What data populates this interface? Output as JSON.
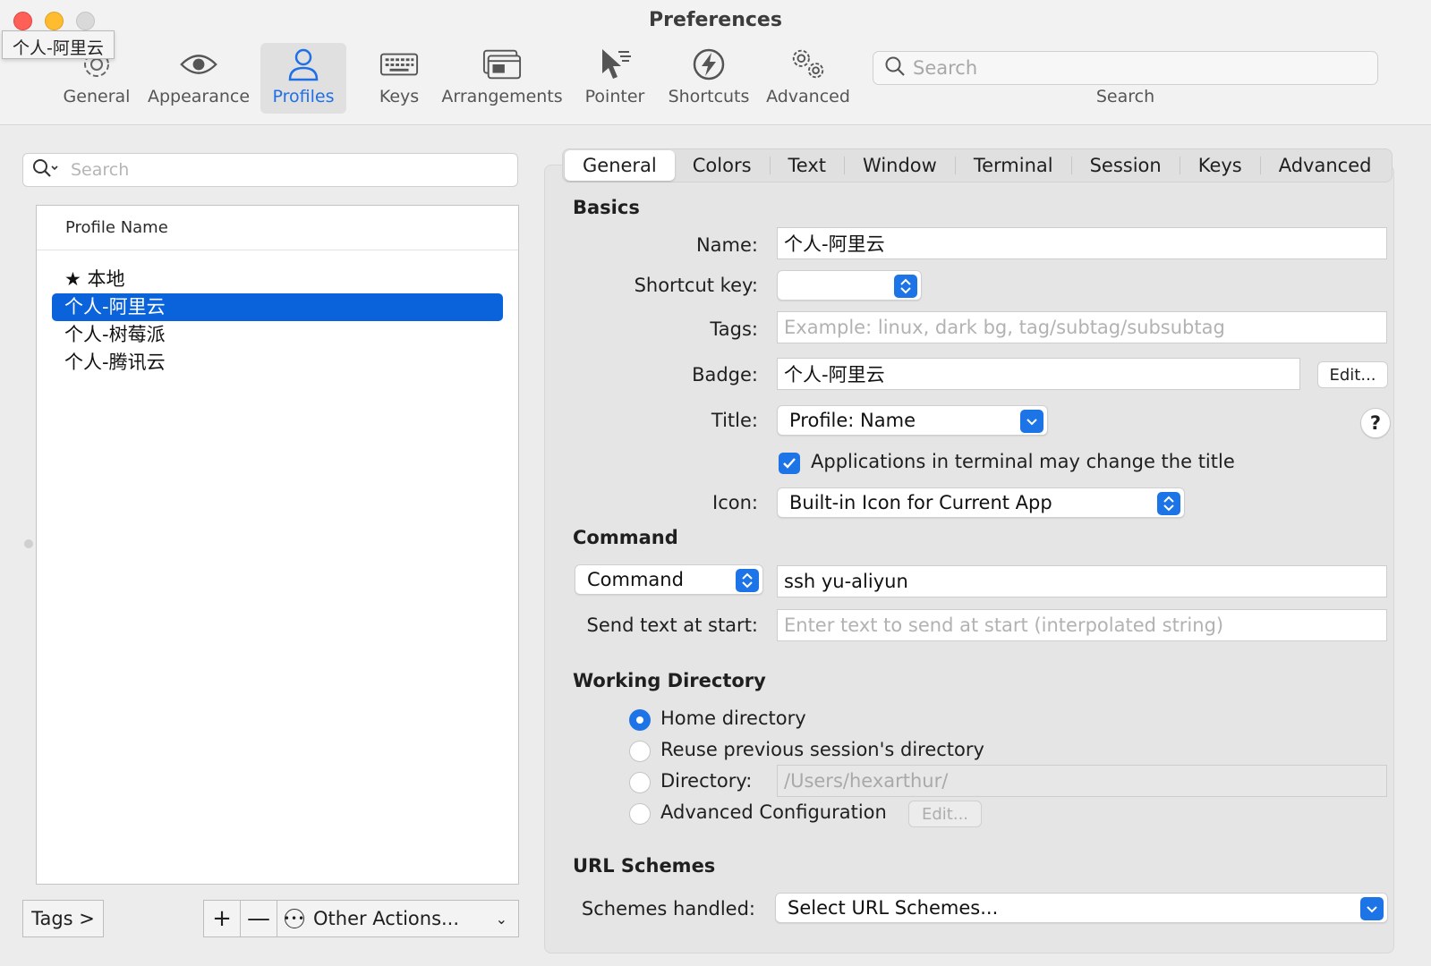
{
  "window": {
    "title": "Preferences",
    "tooltip": "个人-阿里云"
  },
  "toolbar": {
    "items": [
      {
        "label": "General",
        "icon": "gear-icon"
      },
      {
        "label": "Appearance",
        "icon": "eye-icon"
      },
      {
        "label": "Profiles",
        "icon": "person-icon",
        "active": true
      },
      {
        "label": "Keys",
        "icon": "keyboard-icon"
      },
      {
        "label": "Arrangements",
        "icon": "windows-icon"
      },
      {
        "label": "Pointer",
        "icon": "pointer-icon"
      },
      {
        "label": "Shortcuts",
        "icon": "lightning-icon"
      },
      {
        "label": "Advanced",
        "icon": "gears-icon"
      }
    ],
    "search_placeholder": "Search",
    "search_label": "Search"
  },
  "profiles": {
    "search_placeholder": "Search",
    "column_header": "Profile Name",
    "items": [
      {
        "label": "★ 本地",
        "selected": false
      },
      {
        "label": "个人-阿里云",
        "selected": true
      },
      {
        "label": "个人-树莓派",
        "selected": false
      },
      {
        "label": "个人-腾讯云",
        "selected": false
      }
    ],
    "tags_button": "Tags >",
    "add_button": "+",
    "remove_button": "—",
    "other_actions": "Other Actions..."
  },
  "tabs": [
    "General",
    "Colors",
    "Text",
    "Window",
    "Terminal",
    "Session",
    "Keys",
    "Advanced"
  ],
  "basics": {
    "heading": "Basics",
    "name_label": "Name:",
    "name_value": "个人-阿里云",
    "shortcut_label": "Shortcut key:",
    "tags_label": "Tags:",
    "tags_placeholder": "Example: linux, dark bg, tag/subtag/subsubtag",
    "badge_label": "Badge:",
    "badge_value": "个人-阿里云",
    "badge_edit": "Edit...",
    "title_label": "Title:",
    "title_value": "Profile: Name",
    "help": "?",
    "apps_change_title": "Applications in terminal may change the title",
    "icon_label": "Icon:",
    "icon_value": "Built-in Icon for Current App"
  },
  "command": {
    "heading": "Command",
    "type_value": "Command",
    "command_value": "ssh yu-aliyun",
    "send_text_label": "Send text at start:",
    "send_text_placeholder": "Enter text to send at start (interpolated string)"
  },
  "working_directory": {
    "heading": "Working Directory",
    "home": "Home directory",
    "reuse": "Reuse previous session's directory",
    "directory": "Directory:",
    "directory_placeholder": "/Users/hexarthur/",
    "advanced": "Advanced Configuration",
    "advanced_edit": "Edit..."
  },
  "url_schemes": {
    "heading": "URL Schemes",
    "label": "Schemes handled:",
    "value": "Select URL Schemes..."
  },
  "colors": {
    "accent": "#1d74e7",
    "selection": "#0b63dc",
    "close": "#fe5f57",
    "minimize": "#febc2e"
  }
}
